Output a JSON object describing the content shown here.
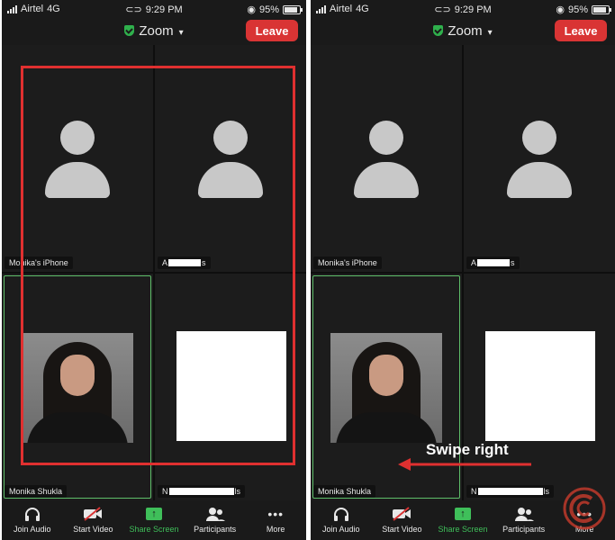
{
  "status": {
    "carrier": "Airtel",
    "network": "4G",
    "time": "9:29 PM",
    "battery": "95%"
  },
  "header": {
    "meeting_title": "Zoom",
    "leave_label": "Leave"
  },
  "participants": [
    {
      "name": "Monika's iPhone"
    },
    {
      "name_prefix": "A",
      "name_suffix": "s"
    },
    {
      "name": "Monika Shukla"
    },
    {
      "name_prefix": "N",
      "name_suffix": "ls"
    }
  ],
  "toolbar": {
    "items": [
      {
        "label": "Join Audio",
        "icon": "headphones-icon"
      },
      {
        "label": "Start Video",
        "icon": "video-off-icon"
      },
      {
        "label": "Share Screen",
        "icon": "share-screen-icon"
      },
      {
        "label": "Participants",
        "icon": "participants-icon"
      },
      {
        "label": "More",
        "icon": "more-dots-icon"
      }
    ]
  },
  "annotation": {
    "swipe_label": "Swipe right",
    "highlight_color": "#e03030"
  },
  "colors": {
    "accent_green": "#3fbf5a",
    "leave_red": "#d93434",
    "background": "#1c1c1c"
  }
}
